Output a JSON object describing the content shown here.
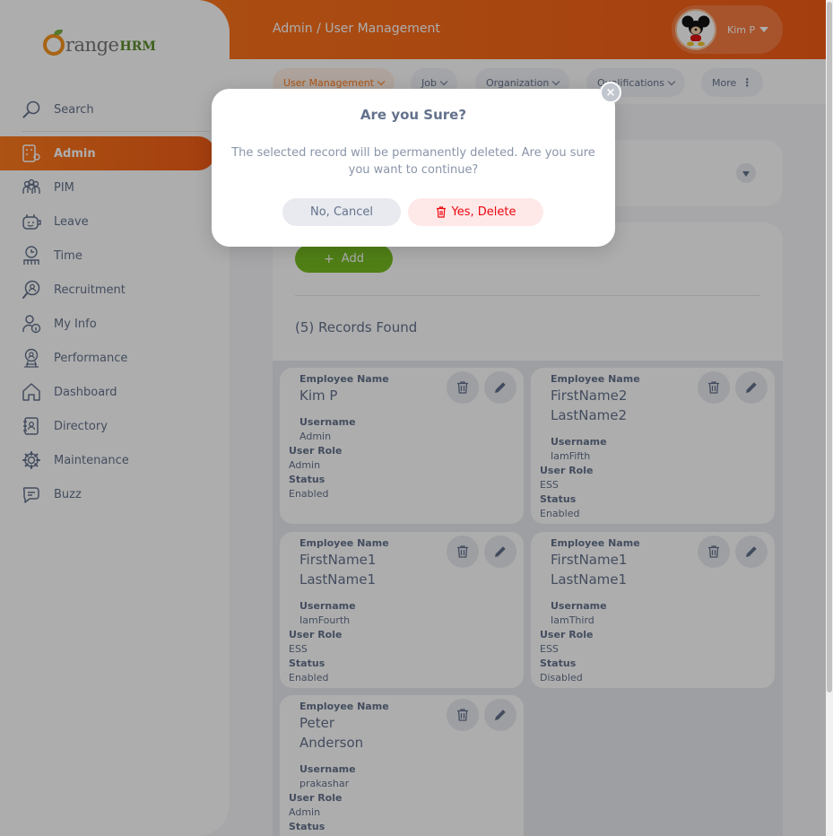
{
  "brand": {
    "logo_text": "range",
    "logo_suffix": "HRM"
  },
  "header": {
    "breadcrumb": "Admin / User Management",
    "user_name": "Kim P"
  },
  "sidebar": {
    "search_label": "Search",
    "items": [
      {
        "label": "Admin",
        "icon": "admin-icon",
        "active": true
      },
      {
        "label": "PIM",
        "icon": "pim-icon"
      },
      {
        "label": "Leave",
        "icon": "leave-icon"
      },
      {
        "label": "Time",
        "icon": "time-icon"
      },
      {
        "label": "Recruitment",
        "icon": "recruitment-icon"
      },
      {
        "label": "My Info",
        "icon": "my-info-icon"
      },
      {
        "label": "Performance",
        "icon": "performance-icon"
      },
      {
        "label": "Dashboard",
        "icon": "dashboard-icon"
      },
      {
        "label": "Directory",
        "icon": "directory-icon"
      },
      {
        "label": "Maintenance",
        "icon": "maintenance-icon"
      },
      {
        "label": "Buzz",
        "icon": "buzz-icon"
      }
    ]
  },
  "tabs": [
    {
      "label": "User Management",
      "active": true
    },
    {
      "label": "Job"
    },
    {
      "label": "Organization"
    },
    {
      "label": "Qualifications"
    },
    {
      "label": "More"
    }
  ],
  "main": {
    "add_label": "Add",
    "add_icon": "+",
    "records_text": "(5) Records Found"
  },
  "labels": {
    "employee_name": "Employee Name",
    "username": "Username",
    "user_role": "User Role",
    "status": "Status"
  },
  "records": [
    {
      "name_line1": "Kim P",
      "name_line2": "",
      "username": "Admin",
      "role": "Admin",
      "status": "Enabled"
    },
    {
      "name_line1": "FirstName2",
      "name_line2": "LastName2",
      "username": "IamFifth",
      "role": "ESS",
      "status": "Enabled"
    },
    {
      "name_line1": "FirstName1",
      "name_line2": "LastName1",
      "username": "IamFourth",
      "role": "ESS",
      "status": "Enabled"
    },
    {
      "name_line1": "FirstName1",
      "name_line2": "LastName1",
      "username": "IamThird",
      "role": "ESS",
      "status": "Disabled"
    },
    {
      "name_line1": "Peter",
      "name_line2": "Anderson",
      "username": "prakashar",
      "role": "Admin",
      "status": ""
    }
  ],
  "dialog": {
    "title": "Are you Sure?",
    "message": "The selected record will be permanently deleted. Are you sure you want to continue?",
    "cancel_label": "No, Cancel",
    "delete_label": "Yes, Delete",
    "close_glyph": "×"
  },
  "colors": {
    "accent": "#ff7b1d",
    "add_green": "#76bc21",
    "danger": "#eb0910",
    "text": "#64728c"
  }
}
